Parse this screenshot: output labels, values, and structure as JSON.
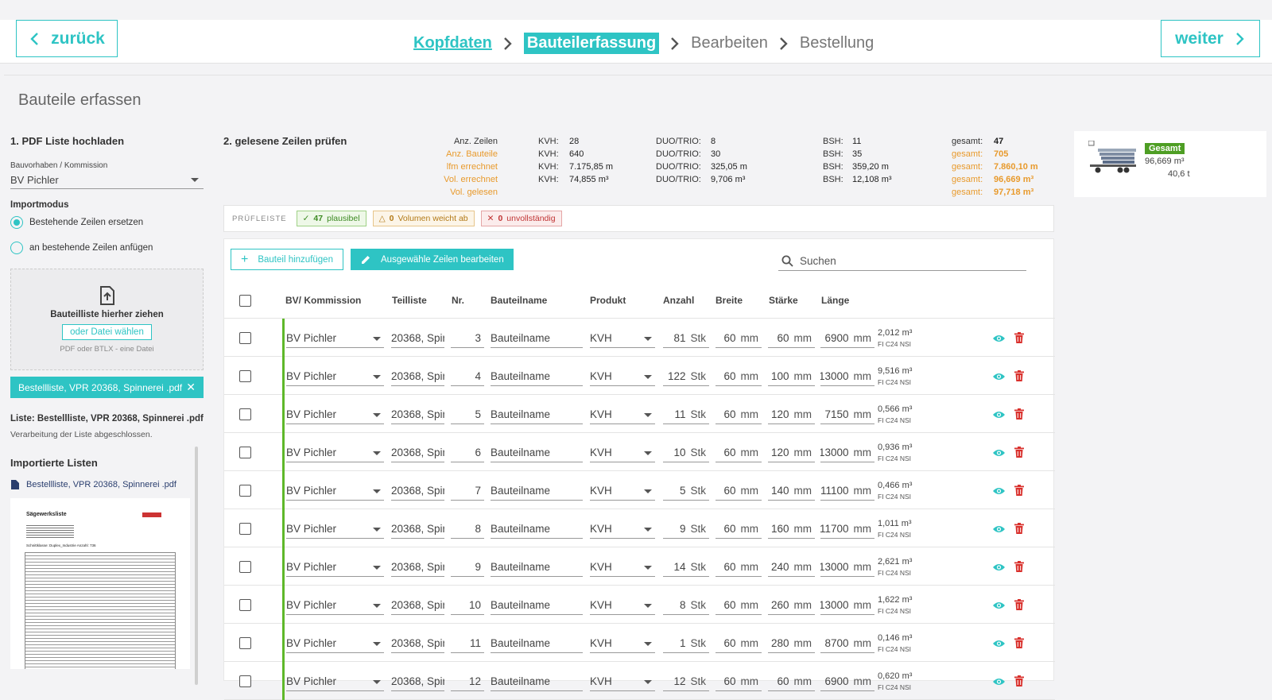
{
  "nav": {
    "back": "zurück",
    "next": "weiter",
    "steps": [
      {
        "label": "Kopfdaten"
      },
      {
        "label": "Bauteilerfassung"
      },
      {
        "label": "Bearbeiten"
      },
      {
        "label": "Bestellung"
      }
    ]
  },
  "page_title": "Bauteile erfassen",
  "sidebar": {
    "upload_title": "1. PDF Liste hochladen",
    "project_label": "Bauvorhaben / Kommission",
    "project_value": "BV Pichler",
    "import_mode_label": "Importmodus",
    "mode_replace": "Bestehende Zeilen ersetzen",
    "mode_append": "an bestehende Zeilen anfügen",
    "dropzone_text": "Bauteilliste hierher ziehen",
    "dropzone_button": "oder Datei wählen",
    "dropzone_hint": "PDF oder BTLX - eine Datei",
    "file_chip": "Bestellliste, VPR 20368, Spinnerei .pdf",
    "list_label": "Liste: Bestellliste, VPR 20368, Spinnerei .pdf",
    "list_status": "Verarbeitung der Liste abgeschlossen.",
    "imported_title": "Importierte Listen",
    "imported_item": "Bestellliste, VPR 20368, Spinnerei .pdf",
    "preview_title": "Sägewerksliste",
    "preview_subtitle": "Schnittklasse: Duplex_Industrie Anzahl: 736"
  },
  "main": {
    "check_title": "2. gelesene Zeilen prüfen",
    "stats_labels": [
      "Anz. Zeilen",
      "Anz. Bauteile",
      "lfm errechnet",
      "Vol. errechnet",
      "Vol. gelesen"
    ],
    "kvh": {
      "key": "KVH:",
      "values": [
        "28",
        "640",
        "7.175,85 m",
        "74,855 m³"
      ]
    },
    "duo": {
      "key": "DUO/TRIO:",
      "values": [
        "8",
        "30",
        "325,05 m",
        "9,706 m³"
      ]
    },
    "bsh": {
      "key": "BSH:",
      "values": [
        "11",
        "35",
        "359,20 m",
        "12,108 m³"
      ]
    },
    "gesamt": {
      "key": "gesamt:",
      "values": [
        "47",
        "705",
        "7.860,10 m",
        "96,669 m³",
        "97,718 m³"
      ]
    },
    "pruefleiste": {
      "label": "PRÜFLEISTE",
      "ok_count": "47",
      "ok_text": "plausibel",
      "warn_count": "0",
      "warn_text": "Volumen weicht ab",
      "err_count": "0",
      "err_text": "unvollständig"
    },
    "add_button": "Bauteil hinzufügen",
    "edit_button": "Ausgewähle Zeilen bearbeiten",
    "search_placeholder": "Suchen",
    "columns": {
      "bv": "BV/ Kommission",
      "teilliste": "Teilliste",
      "nr": "Nr.",
      "name": "Bauteilname",
      "produkt": "Produkt",
      "anzahl": "Anzahl",
      "breite": "Breite",
      "staerke": "Stärke",
      "laenge": "Länge"
    },
    "units": {
      "stk": "Stk",
      "mm": "mm"
    },
    "rows": [
      {
        "bv": "BV Pichler",
        "teilliste": "20368, Spin",
        "nr": "3",
        "name": "Bauteilname",
        "produkt": "KVH",
        "anzahl": "81",
        "breite": "60",
        "staerke": "60",
        "laenge": "6900",
        "vol": "2,012 m³",
        "quality": "FI C24 NSI"
      },
      {
        "bv": "BV Pichler",
        "teilliste": "20368, Spin",
        "nr": "4",
        "name": "Bauteilname",
        "produkt": "KVH",
        "anzahl": "122",
        "breite": "60",
        "staerke": "100",
        "laenge": "13000",
        "vol": "9,516 m³",
        "quality": "FI C24 NSI"
      },
      {
        "bv": "BV Pichler",
        "teilliste": "20368, Spin",
        "nr": "5",
        "name": "Bauteilname",
        "produkt": "KVH",
        "anzahl": "11",
        "breite": "60",
        "staerke": "120",
        "laenge": "7150",
        "vol": "0,566 m³",
        "quality": "FI C24 NSI"
      },
      {
        "bv": "BV Pichler",
        "teilliste": "20368, Spin",
        "nr": "6",
        "name": "Bauteilname",
        "produkt": "KVH",
        "anzahl": "10",
        "breite": "60",
        "staerke": "120",
        "laenge": "13000",
        "vol": "0,936 m³",
        "quality": "FI C24 NSI"
      },
      {
        "bv": "BV Pichler",
        "teilliste": "20368, Spin",
        "nr": "7",
        "name": "Bauteilname",
        "produkt": "KVH",
        "anzahl": "5",
        "breite": "60",
        "staerke": "140",
        "laenge": "11100",
        "vol": "0,466 m³",
        "quality": "FI C24 NSI"
      },
      {
        "bv": "BV Pichler",
        "teilliste": "20368, Spin",
        "nr": "8",
        "name": "Bauteilname",
        "produkt": "KVH",
        "anzahl": "9",
        "breite": "60",
        "staerke": "160",
        "laenge": "11700",
        "vol": "1,011 m³",
        "quality": "FI C24 NSI"
      },
      {
        "bv": "BV Pichler",
        "teilliste": "20368, Spin",
        "nr": "9",
        "name": "Bauteilname",
        "produkt": "KVH",
        "anzahl": "14",
        "breite": "60",
        "staerke": "240",
        "laenge": "13000",
        "vol": "2,621 m³",
        "quality": "FI C24 NSI"
      },
      {
        "bv": "BV Pichler",
        "teilliste": "20368, Spin",
        "nr": "10",
        "name": "Bauteilname",
        "produkt": "KVH",
        "anzahl": "8",
        "breite": "60",
        "staerke": "260",
        "laenge": "13000",
        "vol": "1,622 m³",
        "quality": "FI C24 NSI"
      },
      {
        "bv": "BV Pichler",
        "teilliste": "20368, Spin",
        "nr": "11",
        "name": "Bauteilname",
        "produkt": "KVH",
        "anzahl": "1",
        "breite": "60",
        "staerke": "280",
        "laenge": "8700",
        "vol": "0,146 m³",
        "quality": "FI C24 NSI"
      },
      {
        "bv": "BV Pichler",
        "teilliste": "20368, Spin",
        "nr": "12",
        "name": "Bauteilname",
        "produkt": "KVH",
        "anzahl": "12",
        "breite": "60",
        "staerke": "60",
        "laenge": "6900",
        "vol": "0,620 m³",
        "quality": "FI C24 NSI"
      }
    ]
  },
  "truck_card": {
    "badge": "Gesamt",
    "volume": "96,669 m³",
    "weight": "40,6 t"
  },
  "colors": {
    "accent": "#2ec4c4",
    "orange": "#e89a2c",
    "green": "#5fb82a",
    "red": "#d9302c"
  }
}
